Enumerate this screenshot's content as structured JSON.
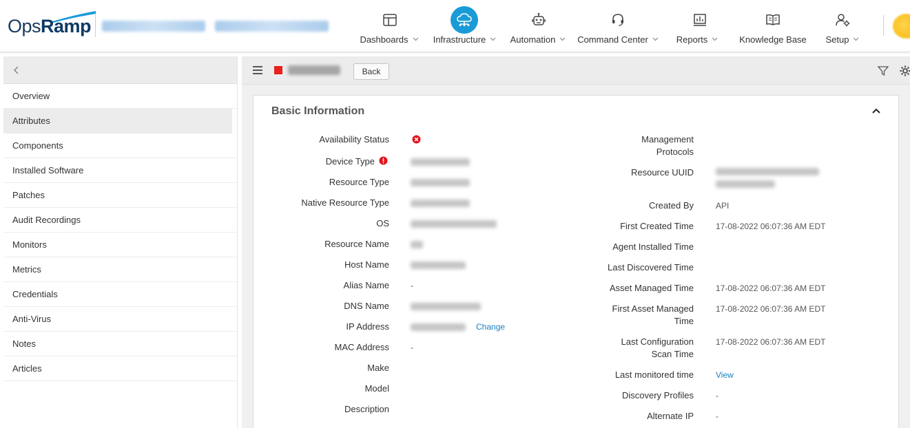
{
  "brand": {
    "logo_ops": "Ops",
    "logo_ramp": "Ramp"
  },
  "nav": {
    "items": [
      {
        "label": "Dashboards",
        "icon": "dashboard-icon",
        "dropdown": true
      },
      {
        "label": "Infrastructure",
        "icon": "cloud-network-icon",
        "dropdown": true,
        "active": true
      },
      {
        "label": "Automation",
        "icon": "robot-icon",
        "dropdown": true
      },
      {
        "label": "Command Center",
        "icon": "headset-icon",
        "dropdown": true
      },
      {
        "label": "Reports",
        "icon": "report-chart-icon",
        "dropdown": true
      },
      {
        "label": "Knowledge Base",
        "icon": "book-icon",
        "dropdown": false
      },
      {
        "label": "Setup",
        "icon": "user-gear-icon",
        "dropdown": true
      }
    ],
    "active_color": "#1a9bd7"
  },
  "sidebar": {
    "items": [
      {
        "label": "Overview"
      },
      {
        "label": "Attributes",
        "active": true
      },
      {
        "label": "Components"
      },
      {
        "label": "Installed Software"
      },
      {
        "label": "Patches"
      },
      {
        "label": "Audit Recordings"
      },
      {
        "label": "Monitors"
      },
      {
        "label": "Metrics"
      },
      {
        "label": "Credentials"
      },
      {
        "label": "Anti-Virus"
      },
      {
        "label": "Notes"
      },
      {
        "label": "Articles"
      }
    ]
  },
  "toolbar": {
    "back_label": "Back",
    "status_color": "#e8211c"
  },
  "card": {
    "title": "Basic Information",
    "left": {
      "availability_status": "Availability Status",
      "device_type": "Device Type",
      "resource_type": "Resource Type",
      "native_resource_type": "Native Resource Type",
      "os": "OS",
      "resource_name": "Resource Name",
      "host_name": "Host Name",
      "alias_name": "Alias Name",
      "alias_value": "-",
      "dns_name": "DNS Name",
      "ip_address": "IP Address",
      "ip_change": "Change",
      "mac_address": "MAC Address",
      "mac_value": "-",
      "make": "Make",
      "model": "Model",
      "description": "Description"
    },
    "right": {
      "management_protocols_1": "Management",
      "management_protocols_2": "Protocols",
      "resource_uuid": "Resource UUID",
      "created_by": "Created By",
      "created_by_value": "API",
      "first_created_time": "First Created Time",
      "first_created_value": "17-08-2022 06:07:36 AM EDT",
      "agent_installed_time": "Agent Installed Time",
      "last_discovered_time": "Last Discovered Time",
      "asset_managed_time": "Asset Managed Time",
      "asset_managed_value": "17-08-2022 06:07:36 AM EDT",
      "first_asset_managed_1": "First Asset Managed",
      "first_asset_managed_2": "Time",
      "first_asset_managed_value": "17-08-2022 06:07:36 AM EDT",
      "last_config_scan_1": "Last Configuration",
      "last_config_scan_2": "Scan Time",
      "last_config_scan_value": "17-08-2022 06:07:36 AM EDT",
      "last_monitored_time": "Last monitored time",
      "last_monitored_link": "View",
      "discovery_profiles": "Discovery Profiles",
      "discovery_profiles_value": "-",
      "alternate_ip": "Alternate IP",
      "alternate_ip_value": "-"
    }
  }
}
